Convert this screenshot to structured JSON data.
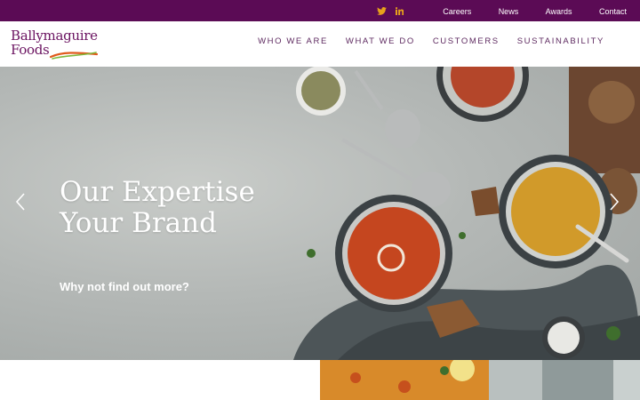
{
  "topbar": {
    "social": [
      {
        "icon": "twitter-icon",
        "color": "#e8a21b"
      },
      {
        "icon": "linkedin-icon",
        "color": "#e8a21b"
      }
    ],
    "links": [
      "Careers",
      "News",
      "Awards",
      "Contact"
    ]
  },
  "brand": {
    "name_line1": "Ballymaguire",
    "name_line2": "Foods",
    "primary_color": "#5b0b55",
    "swoosh_colors": [
      "#e05a1c",
      "#7fb83c"
    ]
  },
  "nav": {
    "items": [
      "WHO WE ARE",
      "WHAT WE DO",
      "CUSTOMERS",
      "SUSTAINABILITY"
    ]
  },
  "hero": {
    "title_line1": "Our Expertise",
    "title_line2": "Your Brand",
    "cta": "Why not find out more?",
    "prev_icon": "chevron-left-icon",
    "next_icon": "chevron-right-icon"
  }
}
